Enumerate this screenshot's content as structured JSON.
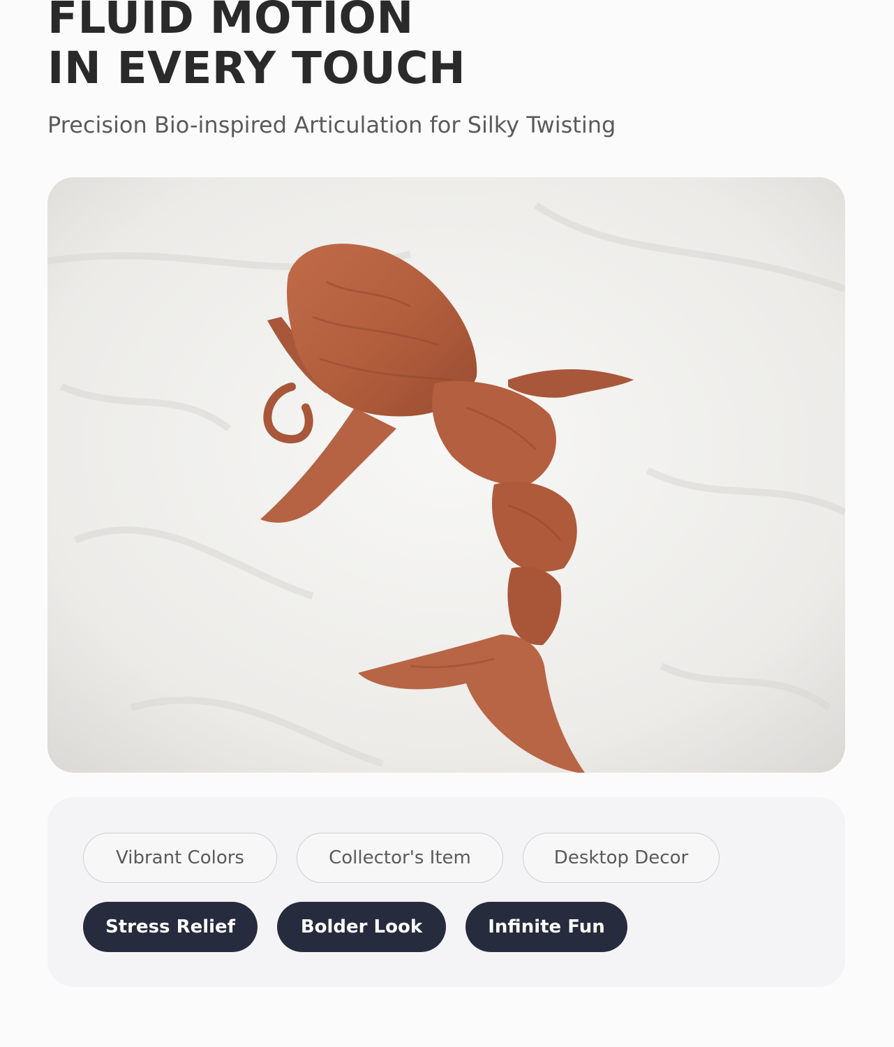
{
  "headline": {
    "line1": "FLUID MOTION",
    "line2": "IN EVERY TOUCH"
  },
  "subtitle": "Precision Bio-inspired Articulation for Silky Twisting",
  "photo": {
    "subject": "articulated-whale-toy",
    "colors": {
      "toy": "#b35f3e",
      "fabric": "#ecebe8"
    }
  },
  "tags": {
    "outlined": [
      "Vibrant Colors",
      "Collector's Item",
      "Desktop Decor"
    ],
    "filled": [
      "Stress Relief",
      "Bolder Look",
      "Infinite Fun"
    ]
  },
  "colors": {
    "heading": "#2a2a2a",
    "subtitle": "#5a5a5a",
    "pill_dark": "#262b3d",
    "pill_light_border": "#cfcfd3"
  }
}
